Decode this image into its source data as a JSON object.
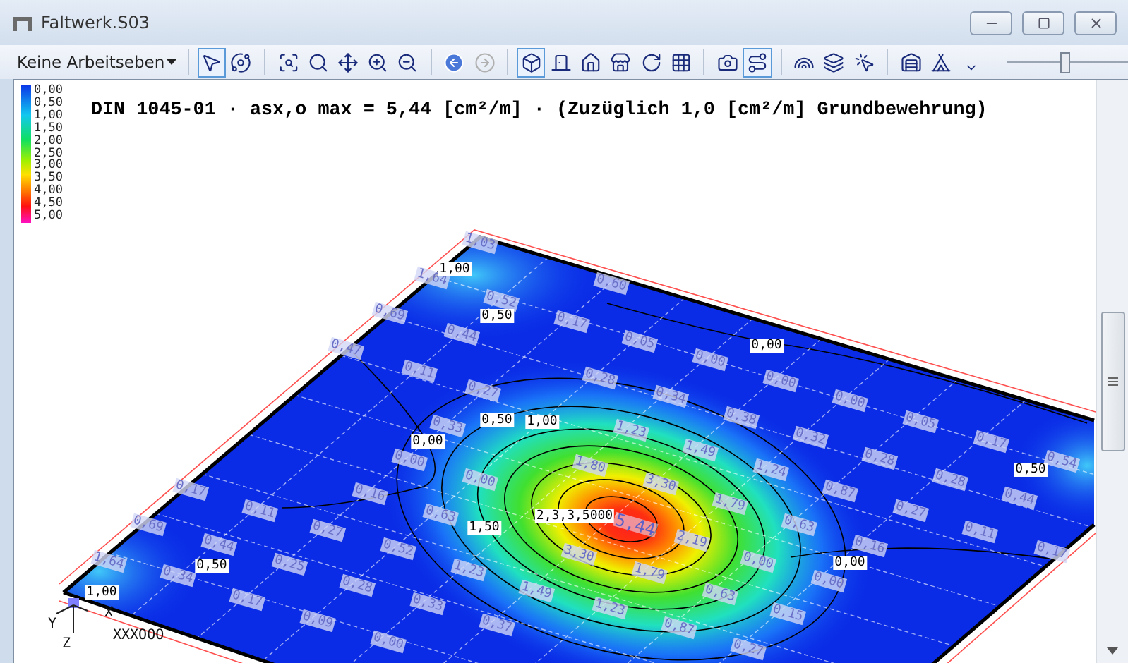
{
  "window": {
    "title": "Faltwerk.S03"
  },
  "toolbar": {
    "workplane": {
      "label": "Keine Arbeitseben"
    },
    "groups": [
      [
        {
          "selected": true,
          "disabled": false
        },
        {
          "selected": false,
          "disabled": false
        }
      ],
      [
        {
          "selected": false,
          "disabled": false
        },
        {
          "selected": false,
          "disabled": false
        },
        {
          "selected": false,
          "disabled": false
        },
        {
          "selected": false,
          "disabled": false
        },
        {
          "selected": false,
          "disabled": false
        }
      ],
      [
        {
          "selected": false,
          "disabled": false
        },
        {
          "selected": false,
          "disabled": true
        }
      ],
      [
        {
          "selected": true,
          "disabled": false
        },
        {
          "selected": false,
          "disabled": false
        },
        {
          "selected": false,
          "disabled": false
        },
        {
          "selected": false,
          "disabled": false
        },
        {
          "selected": false,
          "disabled": false
        },
        {
          "selected": false,
          "disabled": false
        }
      ],
      [
        {
          "selected": false,
          "disabled": false
        },
        {
          "selected": true,
          "disabled": false
        }
      ],
      [
        {
          "selected": false,
          "disabled": false
        },
        {
          "selected": false,
          "disabled": false
        },
        {
          "selected": false,
          "disabled": false
        }
      ],
      [
        {
          "selected": false,
          "disabled": false
        },
        {
          "selected": false,
          "disabled": false
        }
      ]
    ],
    "zoom_slider": {
      "level": 0.48
    }
  },
  "legend": {
    "labels": [
      "0,00",
      "0,50",
      "1,00",
      "1,50",
      "2,00",
      "2,50",
      "3,00",
      "3,50",
      "4,00",
      "4,50",
      "5,00"
    ]
  },
  "result_title": "DIN 1045-01 · asx,o max = 5,44 [cm²/m] ·  (Zuzüglich 1,0 [cm²/m] Grundbewehrung)",
  "plot": {
    "contour_labels": [
      "1,00",
      "0,50",
      "0,00",
      "0,50",
      "1,00",
      "0,00",
      "0,50",
      "1,50",
      "2,3,3,5000",
      "0,00",
      "0,50",
      "1,00"
    ],
    "value_labels": [
      "1,03",
      "1,64",
      "0,69",
      "0,47",
      "0,17",
      "0,69",
      "1,64",
      "0,52",
      "0,44",
      "0,11",
      "0,27",
      "0,33",
      "0,00",
      "0,00",
      "0,11",
      "0,27",
      "0,25",
      "0,44",
      "0,34",
      "0,17",
      "0,09",
      "0,00",
      "0,16",
      "0,63",
      "0,52",
      "1,23",
      "1,49",
      "0,28",
      "0,33",
      "0,37",
      "0,60",
      "0,17",
      "0,05",
      "0,00",
      "0,00",
      "0,00",
      "0,05",
      "0,17",
      "0,54",
      "0,28",
      "0,34",
      "0,38",
      "0,32",
      "0,28",
      "0,28",
      "0,44",
      "1,23",
      "1,49",
      "1,24",
      "0,87",
      "0,27",
      "0,11",
      "0,17",
      "1,80",
      "3,30",
      "1,79",
      "0,63",
      "0,16",
      "2,19",
      "0,00",
      "0,00",
      "1,79",
      "0,63",
      "0,15",
      "1,23",
      "0,87",
      "0,27",
      "3,30"
    ],
    "max_label": "5,44",
    "axes": {
      "y": "Y",
      "x": "X",
      "z": "Z",
      "origin": "XXXOOO"
    }
  }
}
